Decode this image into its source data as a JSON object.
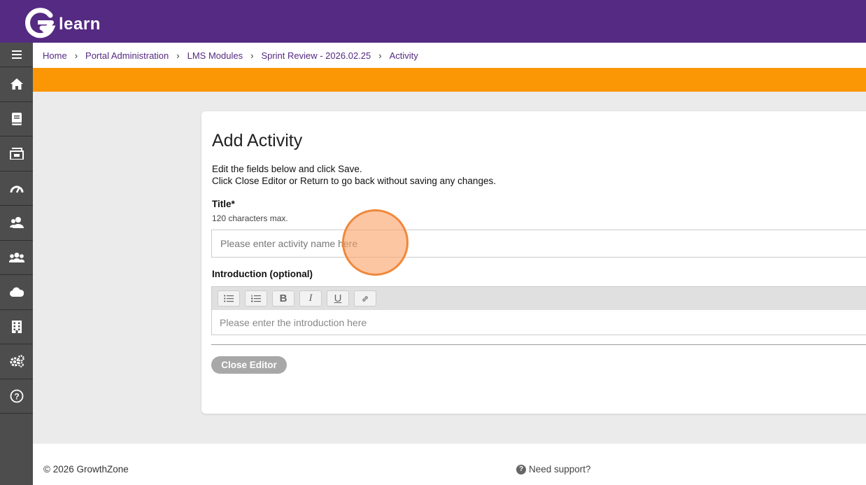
{
  "app": {
    "logo_text": "learn"
  },
  "breadcrumb": [
    {
      "label": "Home"
    },
    {
      "label": "Portal Administration"
    },
    {
      "label": "LMS Modules"
    },
    {
      "label": "Sprint Review - 2026.02.25"
    },
    {
      "label": "Activity"
    }
  ],
  "breadcrumb_separator": "›",
  "sidebar": {
    "items": [
      {
        "icon": "menu-icon"
      },
      {
        "icon": "home-icon"
      },
      {
        "icon": "book-icon"
      },
      {
        "icon": "archive-icon"
      },
      {
        "icon": "dashboard-gauge-icon"
      },
      {
        "icon": "user-group-icon"
      },
      {
        "icon": "users-icon"
      },
      {
        "icon": "cloud-icon"
      },
      {
        "icon": "building-icon"
      },
      {
        "icon": "settings-gears-icon"
      },
      {
        "icon": "help-icon"
      }
    ]
  },
  "form": {
    "heading": "Add Activity",
    "desc_line1": "Edit the fields below and click Save.",
    "desc_line2": "Click Close Editor or Return to go back without saving any changes.",
    "title_label": "Title",
    "title_required_mark": "*",
    "title_hint": "120 characters max.",
    "title_placeholder": "Please enter activity name here",
    "intro_label": "Introduction (optional)",
    "intro_placeholder": "Please enter the introduction here",
    "toolbar": {
      "bullet_list_icon": "bullet-list-icon",
      "numbered_list_icon": "numbered-list-icon",
      "bold": "B",
      "italic": "I",
      "underline": "U",
      "link_icon": "link-icon"
    },
    "close_editor_label": "Close Editor"
  },
  "footer": {
    "copyright": "© 2026 GrowthZone",
    "support": "Need support?",
    "support_icon_glyph": "?"
  },
  "colors": {
    "brand_purple": "#552a82",
    "accent_orange": "#fb9604",
    "sidebar_bg": "#4d4d4d"
  }
}
